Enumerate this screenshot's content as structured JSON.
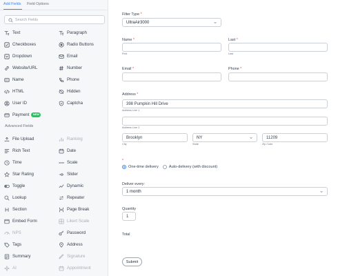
{
  "sidebar": {
    "tabs": [
      {
        "label": "Add Fields"
      },
      {
        "label": "Field Options"
      }
    ],
    "search_placeholder": "Search Fields",
    "basic_fields": [
      {
        "label": "Text",
        "icon": "text-icon"
      },
      {
        "label": "Paragraph",
        "icon": "paragraph-icon"
      },
      {
        "label": "Checkboxes",
        "icon": "checkbox-icon"
      },
      {
        "label": "Radio Buttons",
        "icon": "radio-icon"
      },
      {
        "label": "Dropdown",
        "icon": "dropdown-icon"
      },
      {
        "label": "Email",
        "icon": "email-icon"
      },
      {
        "label": "Website/URL",
        "icon": "link-icon"
      },
      {
        "label": "Number",
        "icon": "hash-icon"
      },
      {
        "label": "Name",
        "icon": "id-card-icon"
      },
      {
        "label": "Phone",
        "icon": "phone-icon"
      },
      {
        "label": "HTML",
        "icon": "code-icon"
      },
      {
        "label": "Hidden",
        "icon": "eye-off-icon"
      },
      {
        "label": "User ID",
        "icon": "user-icon"
      },
      {
        "label": "Captcha",
        "icon": "shield-check-icon"
      },
      {
        "label": "Payment",
        "icon": "credit-card-icon",
        "badge": "NEW"
      }
    ],
    "advanced_label": "Advanced Fields",
    "advanced_fields": [
      {
        "label": "File Upload",
        "icon": "upload-icon",
        "disabled": false
      },
      {
        "label": "Ranking",
        "icon": "ranking-icon",
        "disabled": true
      },
      {
        "label": "Rich Text",
        "icon": "rich-text-icon",
        "disabled": false
      },
      {
        "label": "Date",
        "icon": "calendar-icon",
        "disabled": false
      },
      {
        "label": "Time",
        "icon": "clock-icon",
        "disabled": false
      },
      {
        "label": "Scale",
        "icon": "scale-icon",
        "disabled": false
      },
      {
        "label": "Star Rating",
        "icon": "star-icon",
        "disabled": false
      },
      {
        "label": "Slider",
        "icon": "slider-icon",
        "disabled": false
      },
      {
        "label": "Toggle",
        "icon": "toggle-icon",
        "disabled": false
      },
      {
        "label": "Dynamic",
        "icon": "dynamic-icon",
        "disabled": false
      },
      {
        "label": "Lookup",
        "icon": "lookup-icon",
        "disabled": false
      },
      {
        "label": "Repeater",
        "icon": "repeater-icon",
        "disabled": false
      },
      {
        "label": "Section",
        "icon": "section-icon",
        "disabled": false
      },
      {
        "label": "Page Break",
        "icon": "page-break-icon",
        "disabled": false
      },
      {
        "label": "Embed Form",
        "icon": "embed-icon",
        "disabled": false
      },
      {
        "label": "Likert Scale",
        "icon": "likert-icon",
        "disabled": true
      },
      {
        "label": "NPS",
        "icon": "nps-icon",
        "disabled": true
      },
      {
        "label": "Password",
        "icon": "key-icon",
        "disabled": false
      },
      {
        "label": "Tags",
        "icon": "tag-icon",
        "disabled": false
      },
      {
        "label": "Address",
        "icon": "location-icon",
        "disabled": false
      },
      {
        "label": "Summary",
        "icon": "summary-icon",
        "disabled": false
      },
      {
        "label": "Signature",
        "icon": "signature-icon",
        "disabled": true
      },
      {
        "label": "AI",
        "icon": "ai-icon",
        "disabled": true
      },
      {
        "label": "Appointment",
        "icon": "appointment-icon",
        "disabled": true
      }
    ]
  },
  "form": {
    "filter_type": {
      "label": "Filter Type",
      "required": "*",
      "value": "UltraAir3000"
    },
    "first": {
      "label": "Name",
      "required": "*",
      "value": "",
      "sublabel": "First"
    },
    "last": {
      "label": "Last",
      "required": "*",
      "value": "",
      "sublabel": "Last"
    },
    "email": {
      "label": "Email",
      "required": "*",
      "value": ""
    },
    "phone": {
      "label": "Phone",
      "required": "*",
      "value": ""
    },
    "address": {
      "label": "Address",
      "required": "*",
      "line1": "398 Pumpkin Hill Drive",
      "line1_sublabel": "Address Line 1",
      "line2": "",
      "line2_sublabel": "Address Line 2",
      "city": "Brooklyn",
      "city_sublabel": "City",
      "state": "NY",
      "state_sublabel": "State",
      "zip": "11209",
      "zip_sublabel": "Zip Code"
    },
    "delivery": {
      "required": "*",
      "options": [
        {
          "label": "One-time delivery",
          "selected": true
        },
        {
          "label": "Auto-delivery (with discount)",
          "selected": false
        }
      ]
    },
    "deliver_every": {
      "label": "Deliver every:",
      "value": "1 month"
    },
    "quantity": {
      "label": "Quantity",
      "value": "1"
    },
    "total": {
      "label": "Total"
    },
    "submit_label": "Submit"
  },
  "colors": {
    "accent": "#3b82f6",
    "required": "#ef4444",
    "badge": "#22c55e",
    "sidebar_bg": "#f6f7f9"
  }
}
